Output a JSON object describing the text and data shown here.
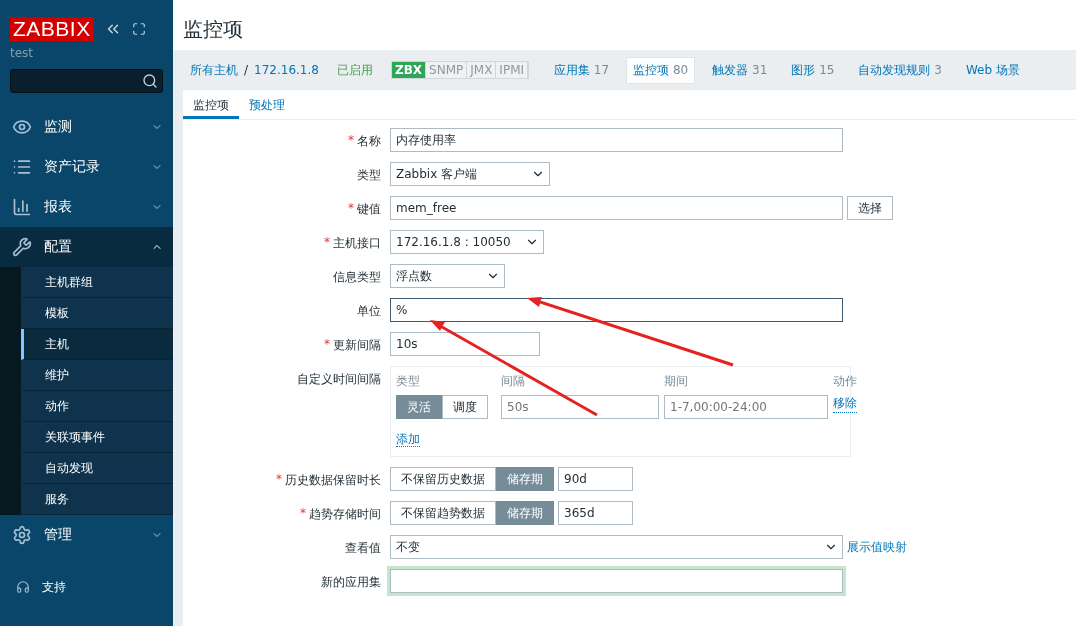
{
  "sidebar": {
    "logo": "ZABBIX",
    "user": "test",
    "menu": [
      {
        "label": "监测",
        "expanded": false
      },
      {
        "label": "资产记录",
        "expanded": false
      },
      {
        "label": "报表",
        "expanded": false
      },
      {
        "label": "配置",
        "expanded": true,
        "children": [
          {
            "label": "主机群组",
            "selected": false
          },
          {
            "label": "模板",
            "selected": false
          },
          {
            "label": "主机",
            "selected": true
          },
          {
            "label": "维护",
            "selected": false
          },
          {
            "label": "动作",
            "selected": false
          },
          {
            "label": "关联项事件",
            "selected": false
          },
          {
            "label": "自动发现",
            "selected": false
          },
          {
            "label": "服务",
            "selected": false
          }
        ]
      },
      {
        "label": "管理",
        "expanded": false
      }
    ],
    "support": "支持"
  },
  "header": {
    "title": "监控项"
  },
  "breadcrumb": {
    "all_hosts": "所有主机",
    "separator": "/",
    "host": "172.16.1.8",
    "status": "已启用",
    "availability": [
      {
        "label": "ZBX",
        "on": true
      },
      {
        "label": "SNMP",
        "on": false
      },
      {
        "label": "JMX",
        "on": false
      },
      {
        "label": "IPMI",
        "on": false
      }
    ],
    "nav": [
      {
        "label": "应用集",
        "count": "17",
        "selected": false
      },
      {
        "label": "监控项",
        "count": "80",
        "selected": true
      },
      {
        "label": "触发器",
        "count": "31",
        "selected": false
      },
      {
        "label": "图形",
        "count": "15",
        "selected": false
      },
      {
        "label": "自动发现规则",
        "count": "3",
        "selected": false
      },
      {
        "label": "Web 场景",
        "selected": false
      }
    ]
  },
  "form_tabs": [
    {
      "label": "监控项",
      "selected": true
    },
    {
      "label": "预处理",
      "selected": false
    }
  ],
  "fields": [
    {
      "kind": "text",
      "required_mark": "*",
      "label": "名称",
      "value": "内存使用率"
    },
    {
      "kind": "select",
      "label": "类型",
      "value": "Zabbix 客户端"
    },
    {
      "kind": "text_button",
      "required_mark": "*",
      "label": "键值",
      "value": "mem_free",
      "button": "选择"
    },
    {
      "kind": "select",
      "required_mark": "*",
      "label": "主机接口",
      "value": "172.16.1.8 : 10050"
    },
    {
      "kind": "select",
      "label": "信息类型",
      "value": "浮点数"
    },
    {
      "kind": "text",
      "label": "单位",
      "value": "%",
      "focused": true
    },
    {
      "kind": "text",
      "required_mark": "*",
      "label": "更新间隔",
      "value": "10s"
    },
    {
      "kind": "intervals",
      "label": "自定义时间间隔",
      "columns": [
        "类型",
        "间隔",
        "期间",
        "动作"
      ],
      "rows": [
        {
          "modes": [
            {
              "label": "灵活",
              "selected": true
            },
            {
              "label": "调度",
              "selected": false
            }
          ],
          "interval_placeholder": "50s",
          "period_placeholder": "1-7,00:00-24:00",
          "remove": "移除"
        }
      ],
      "add": "添加"
    },
    {
      "kind": "storage",
      "required_mark": "*",
      "label": "历史数据保留时长",
      "modes": [
        {
          "label": "不保留历史数据",
          "selected": false
        },
        {
          "label": "储存期",
          "selected": true
        }
      ],
      "value": "90d"
    },
    {
      "kind": "storage",
      "required_mark": "*",
      "label": "趋势存储时间",
      "modes": [
        {
          "label": "不保留趋势数据",
          "selected": false
        },
        {
          "label": "储存期",
          "selected": true
        }
      ],
      "value": "365d"
    },
    {
      "kind": "select_link",
      "label": "查看值",
      "value": "不变",
      "link": "展示值映射"
    },
    {
      "kind": "text",
      "label": "新的应用集",
      "highlight": true
    }
  ]
}
